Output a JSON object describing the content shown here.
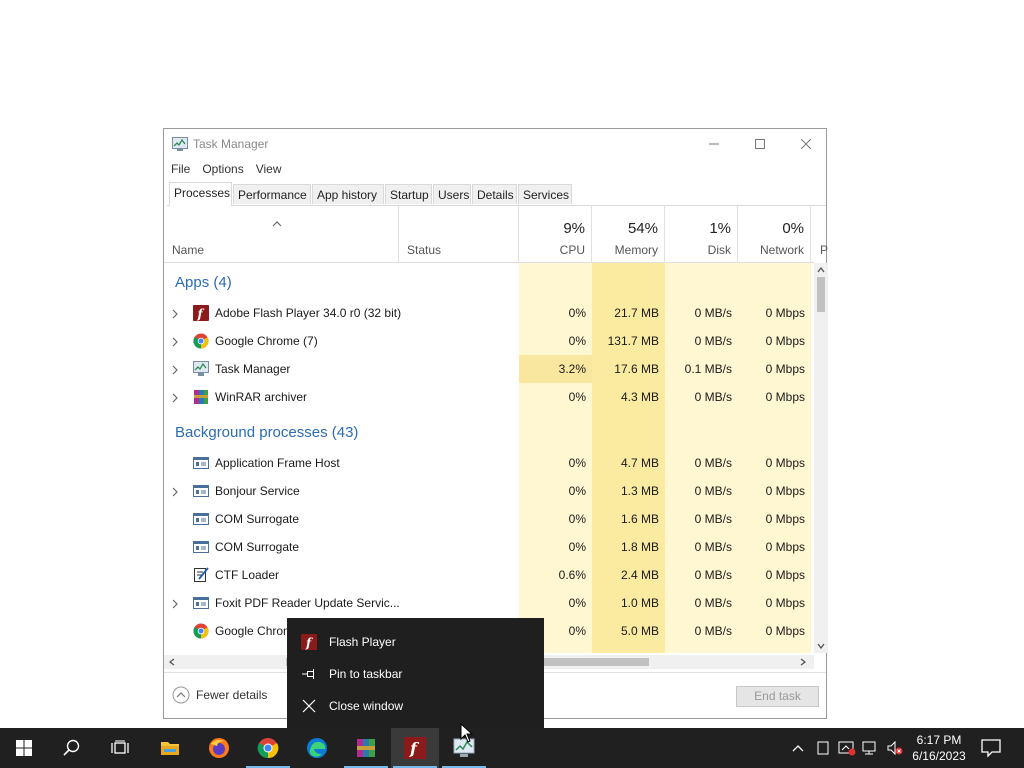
{
  "window": {
    "title": "Task Manager",
    "menu": [
      "File",
      "Options",
      "View"
    ],
    "tabs": [
      "Processes",
      "Performance",
      "App history",
      "Startup",
      "Users",
      "Details",
      "Services"
    ],
    "active_tab": "Processes"
  },
  "columns": {
    "name": "Name",
    "status": "Status",
    "cpu": {
      "pct": "9%",
      "label": "CPU"
    },
    "memory": {
      "pct": "54%",
      "label": "Memory"
    },
    "disk": {
      "pct": "1%",
      "label": "Disk"
    },
    "network": {
      "pct": "0%",
      "label": "Network"
    },
    "power_partial": "P"
  },
  "groups": {
    "apps": "Apps (4)",
    "background": "Background processes (43)"
  },
  "apps": [
    {
      "name": "Adobe Flash Player 34.0 r0 (32 bit)",
      "icon": "flash-icon",
      "cpu": "0%",
      "memory": "21.7 MB",
      "disk": "0 MB/s",
      "network": "0 Mbps",
      "expandable": true
    },
    {
      "name": "Google Chrome (7)",
      "icon": "chrome-icon",
      "cpu": "0%",
      "memory": "131.7 MB",
      "disk": "0 MB/s",
      "network": "0 Mbps",
      "expandable": true
    },
    {
      "name": "Task Manager",
      "icon": "task-manager-icon",
      "cpu": "3.2%",
      "memory": "17.6 MB",
      "disk": "0.1 MB/s",
      "network": "0 Mbps",
      "expandable": true
    },
    {
      "name": "WinRAR archiver",
      "icon": "winrar-icon",
      "cpu": "0%",
      "memory": "4.3 MB",
      "disk": "0 MB/s",
      "network": "0 Mbps",
      "expandable": true
    }
  ],
  "background": [
    {
      "name": "Application Frame Host",
      "icon": "service-window-icon",
      "cpu": "0%",
      "memory": "4.7 MB",
      "disk": "0 MB/s",
      "network": "0 Mbps",
      "expandable": false
    },
    {
      "name": "Bonjour Service",
      "icon": "service-window-icon",
      "cpu": "0%",
      "memory": "1.3 MB",
      "disk": "0 MB/s",
      "network": "0 Mbps",
      "expandable": true
    },
    {
      "name": "COM Surrogate",
      "icon": "service-window-icon",
      "cpu": "0%",
      "memory": "1.6 MB",
      "disk": "0 MB/s",
      "network": "0 Mbps",
      "expandable": false
    },
    {
      "name": "COM Surrogate",
      "icon": "service-window-icon",
      "cpu": "0%",
      "memory": "1.8 MB",
      "disk": "0 MB/s",
      "network": "0 Mbps",
      "expandable": false
    },
    {
      "name": "CTF Loader",
      "icon": "ctf-loader-icon",
      "cpu": "0.6%",
      "memory": "2.4 MB",
      "disk": "0 MB/s",
      "network": "0 Mbps",
      "expandable": false
    },
    {
      "name": "Foxit PDF Reader Update Servic...",
      "icon": "service-window-icon",
      "cpu": "0%",
      "memory": "1.0 MB",
      "disk": "0 MB/s",
      "network": "0 Mbps",
      "expandable": true
    },
    {
      "name": "Google Chrome",
      "icon": "chrome-icon",
      "cpu": "0%",
      "memory": "5.0 MB",
      "disk": "0 MB/s",
      "network": "0 Mbps",
      "expandable": false
    }
  ],
  "footer": {
    "fewer_details": "Fewer details",
    "end_task": "End task"
  },
  "context_menu": [
    {
      "label": "Flash Player",
      "icon": "flash-icon"
    },
    {
      "label": "Pin to taskbar",
      "icon": "pin-icon"
    },
    {
      "label": "Close window",
      "icon": "close-icon"
    }
  ],
  "taskbar": {
    "apps": [
      "start-icon",
      "search-icon",
      "task-view-icon",
      "file-explorer-icon",
      "firefox-icon",
      "chrome-icon",
      "edge-icon",
      "winrar-icon",
      "flash-icon",
      "task-manager-icon"
    ],
    "tray": [
      "chevron-up-icon",
      "tablet-icon",
      "network-warning-icon",
      "network-icon",
      "volume-muted-icon"
    ],
    "time": "6:17 PM",
    "date": "6/16/2023"
  },
  "colors": {
    "group_text": "#2b6cb4",
    "cpu_heat": "#fff7d1",
    "cpu_heat_high": "#fff0b3",
    "mem_heat": "#fbeba0",
    "context_bg": "#1f1f1f",
    "taskbar_bg": "#202020"
  }
}
